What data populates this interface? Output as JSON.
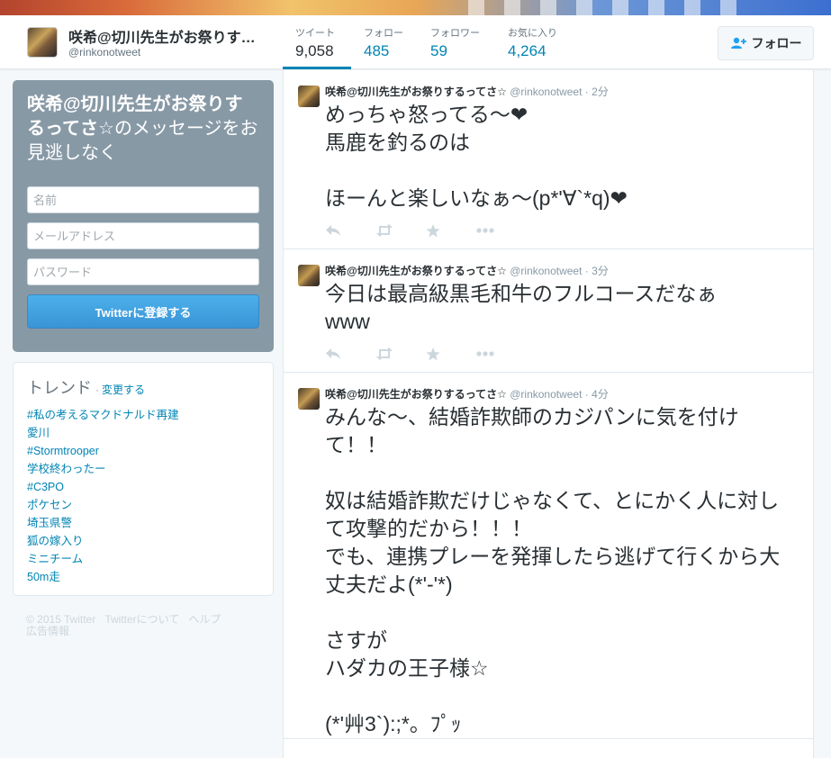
{
  "header": {
    "name": "咲希@切川先生がお祭りするってさ☆",
    "handle": "@rinkonotweet",
    "stats": [
      {
        "label": "ツイート",
        "value": "9,058"
      },
      {
        "label": "フォロー",
        "value": "485"
      },
      {
        "label": "フォロワー",
        "value": "59"
      },
      {
        "label": "お気に入り",
        "value": "4,264"
      }
    ],
    "follow_label": "フォロー"
  },
  "signup": {
    "title_bold": "咲希@切川先生がお祭りするってさ☆",
    "title_rest": "のメッセージをお見逃しなく",
    "name_placeholder": "名前",
    "email_placeholder": "メールアドレス",
    "password_placeholder": "パスワード",
    "button_label": "Twitterに登録する"
  },
  "trends": {
    "title": "トレンド",
    "dot": "·",
    "change_label": "変更する",
    "items": [
      "#私の考えるマクドナルド再建",
      "愛川",
      "#Stormtrooper",
      "学校終わったー",
      "#C3PO",
      "ポケセン",
      "埼玉県警",
      "狐の嫁入り",
      "ミニチーム",
      "50m走"
    ]
  },
  "footer": {
    "links": [
      "© 2015 Twitter",
      "Twitterについて",
      "ヘルプ",
      "広告情報"
    ]
  },
  "tweets": [
    {
      "name": "咲希@切川先生がお祭りするってさ☆",
      "handle": "@rinkonotweet",
      "sep": "·",
      "time": "2分",
      "text": "めっちゃ怒ってる〜❤\n馬鹿を釣るのは\n\nほーんと楽しいなぁ〜(p*'∀`*q)❤"
    },
    {
      "name": "咲希@切川先生がお祭りするってさ☆",
      "handle": "@rinkonotweet",
      "sep": "·",
      "time": "3分",
      "text": "今日は最高級黒毛和牛のフルコースだなぁ\nwww"
    },
    {
      "name": "咲希@切川先生がお祭りするってさ☆",
      "handle": "@rinkonotweet",
      "sep": "·",
      "time": "4分",
      "text": "みんな〜、結婚詐欺師のカジパンに気を付けて！！\n\n奴は結婚詐欺だけじゃなくて、とにかく人に対して攻撃的だから！！！\nでも、連携プレーを発揮したら逃げて行くから大丈夫だよ(*'-'*)\n\nさすが\nハダカの王子様☆\n\n(*'艸3`):;*。ﾌﾟｯ"
    }
  ]
}
